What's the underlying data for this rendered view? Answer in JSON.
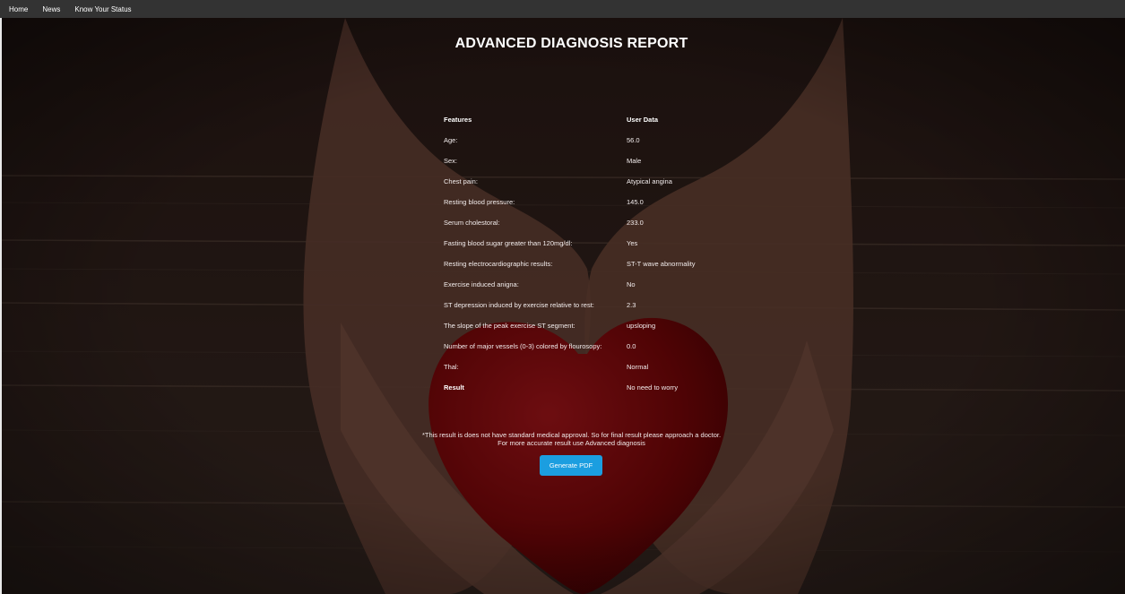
{
  "nav": {
    "items": [
      "Home",
      "News",
      "Know Your Status"
    ]
  },
  "page": {
    "title": "ADVANCED DIAGNOSIS REPORT"
  },
  "table": {
    "headers": [
      "Features",
      "User Data"
    ],
    "rows": [
      {
        "feature": "Age:",
        "value": "56.0"
      },
      {
        "feature": "Sex:",
        "value": "Male"
      },
      {
        "feature": "Chest pain:",
        "value": "Atypical angina"
      },
      {
        "feature": "Resting blood pressure:",
        "value": "145.0"
      },
      {
        "feature": "Serum cholestoral:",
        "value": "233.0"
      },
      {
        "feature": "Fasting blood sugar greater than 120mg/dl:",
        "value": "Yes"
      },
      {
        "feature": "Resting electrocardiographic results:",
        "value": "ST-T wave abnormality"
      },
      {
        "feature": "Exercise induced anigna:",
        "value": "No"
      },
      {
        "feature": "ST depression induced by exercise relative to rest:",
        "value": "2.3"
      },
      {
        "feature": "The slope of the peak exercise ST segment:",
        "value": "upsloping"
      },
      {
        "feature": "Number of major vessels (0-3) colored by flourosopy:",
        "value": "0.0"
      },
      {
        "feature": "Thal:",
        "value": "Normal"
      },
      {
        "feature": "Result",
        "value": "No need to worry"
      }
    ]
  },
  "disclaimer": {
    "line1": "*This result is does not have standard medical approval. So for final result please approach a doctor.",
    "line2": "For more accurate result use Advanced diagnosis"
  },
  "actions": {
    "generate_pdf_label": "Generate PDF"
  },
  "colors": {
    "navbar": "#333333",
    "button": "#1b9ee0",
    "heart": "#8e0c0c"
  }
}
